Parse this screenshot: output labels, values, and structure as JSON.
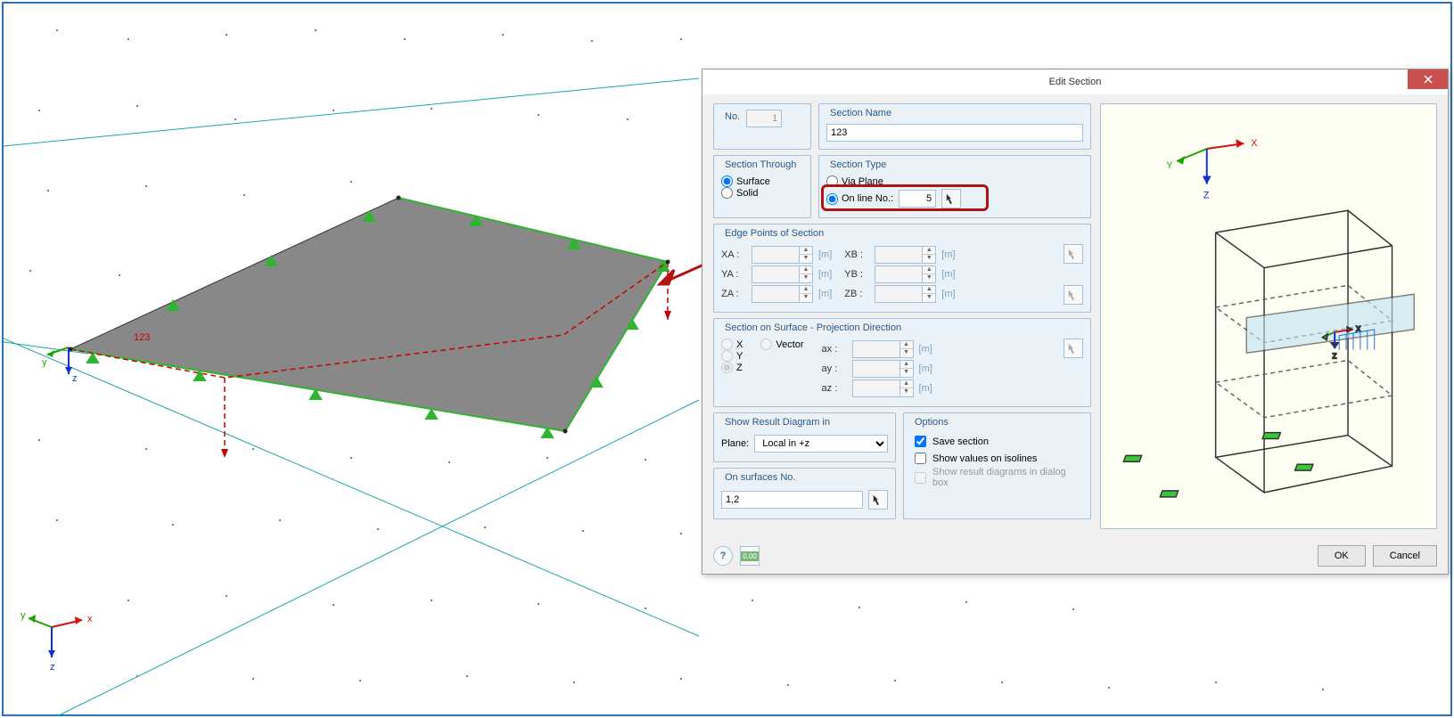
{
  "dialog": {
    "title": "Edit Section",
    "no_label": "No.",
    "no_value": "1",
    "name_label": "Section Name",
    "name_value": "123",
    "section_through": {
      "title": "Section Through",
      "surface": "Surface",
      "solid": "Solid"
    },
    "section_type": {
      "title": "Section Type",
      "via_plane": "Via Plane",
      "on_line": "On line No.:",
      "on_line_value": "5"
    },
    "edge_points": {
      "title": "Edge Points of Section",
      "xa": "XA :",
      "ya": "YA :",
      "za": "ZA :",
      "xb": "XB :",
      "yb": "YB :",
      "zb": "ZB :",
      "unit": "[m]"
    },
    "projection": {
      "title": "Section on Surface - Projection Direction",
      "x": "X",
      "y": "Y",
      "z": "Z",
      "vector": "Vector",
      "ax": "ax :",
      "ay": "ay :",
      "az": "az :",
      "unit": "[m]"
    },
    "result_diagram": {
      "title": "Show Result Diagram in",
      "plane_label": "Plane:",
      "plane_value": "Local in +z"
    },
    "on_surfaces": {
      "title": "On surfaces No.",
      "value": "1,2"
    },
    "options": {
      "title": "Options",
      "save": "Save section",
      "show_values": "Show values on isolines",
      "show_diagrams": "Show result diagrams in dialog box"
    },
    "ok": "OK",
    "cancel": "Cancel"
  },
  "viewport": {
    "section_label": "123",
    "axis_y": "y",
    "axis_z": "z",
    "axis_x": "x",
    "preview_axis_x": "X",
    "preview_axis_y": "Y",
    "preview_axis_z": "Z"
  }
}
